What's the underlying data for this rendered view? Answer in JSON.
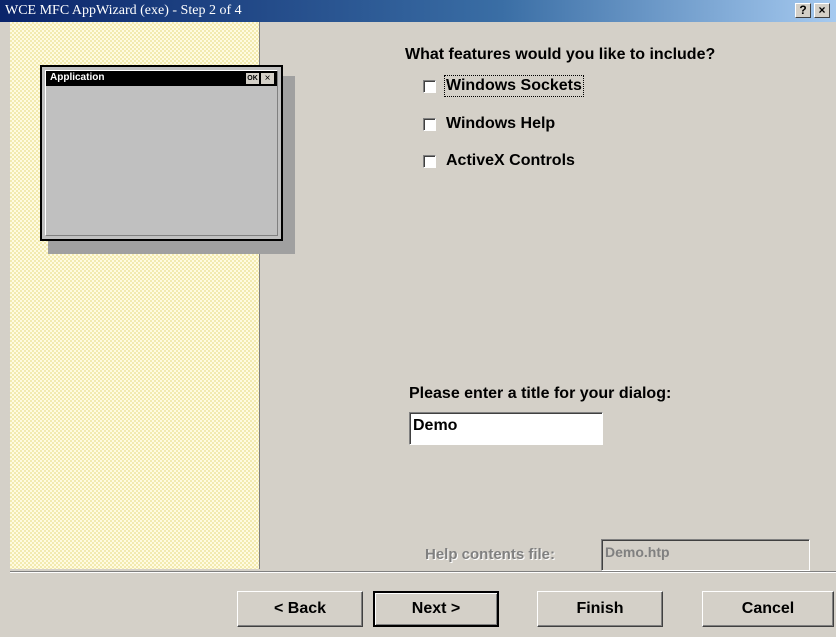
{
  "window": {
    "title": "WCE MFC AppWizard (exe) - Step 2 of 4",
    "help_button": "?",
    "close_button": "×"
  },
  "preview": {
    "title": "Application",
    "ok_button": "OK",
    "close_button": "×"
  },
  "features": {
    "question": "What features would you like to include?",
    "options": [
      {
        "label": "Windows Sockets",
        "checked": false
      },
      {
        "label": "Windows Help",
        "checked": false
      },
      {
        "label": "ActiveX Controls",
        "checked": false
      }
    ]
  },
  "dialog_title": {
    "label": "Please enter a title for your dialog:",
    "value": "Demo"
  },
  "help_file": {
    "label": "Help contents file:",
    "value": "Demo.htp"
  },
  "buttons": {
    "back": "< Back",
    "next": "Next >",
    "finish": "Finish",
    "cancel": "Cancel"
  }
}
